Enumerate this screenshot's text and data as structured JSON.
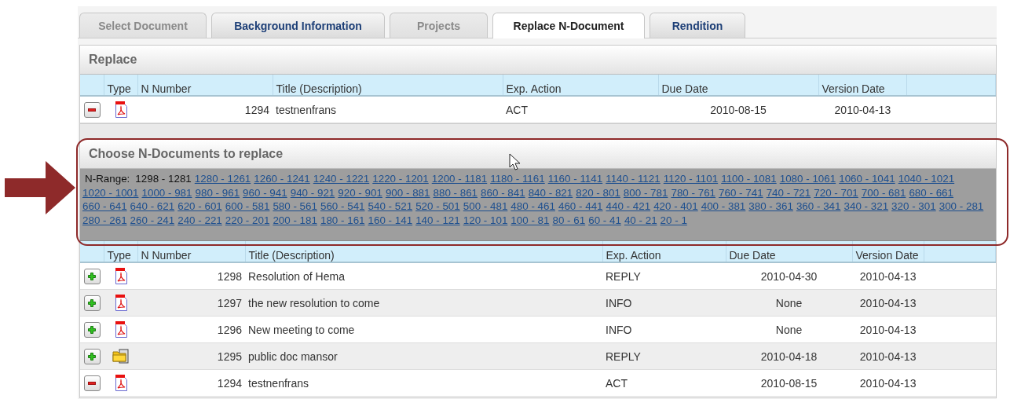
{
  "tabs": [
    {
      "label": "Select Document",
      "selected": false,
      "disabled": true
    },
    {
      "label": "Background Information",
      "selected": false,
      "disabled": false
    },
    {
      "label": "Projects",
      "selected": false,
      "disabled": true
    },
    {
      "label": "Replace N-Document",
      "selected": true,
      "disabled": false
    },
    {
      "label": "Rendition",
      "selected": false,
      "disabled": false
    }
  ],
  "replace": {
    "title": "Replace",
    "table": {
      "columns": [
        "Type",
        "N Number",
        "Title (Description)",
        "Exp. Action",
        "Due Date",
        "Version Date"
      ],
      "rows": [
        {
          "action": {
            "kind": "remove"
          },
          "type": {
            "kind": "pdf"
          },
          "n_number": "1294",
          "title": "testnenfrans",
          "exp_action": "ACT",
          "due_date": "2010-08-15",
          "version_date": "2010-04-13"
        }
      ]
    }
  },
  "choose": {
    "title": "Choose N-Documents to replace",
    "range_label": "N-Range:",
    "ranges": [
      {
        "label": "1298 - 1281",
        "selected": true
      },
      {
        "label": "1280 - 1261",
        "selected": false
      },
      {
        "label": "1260 - 1241",
        "selected": false
      },
      {
        "label": "1240 - 1221",
        "selected": false
      },
      {
        "label": "1220 - 1201",
        "selected": false
      },
      {
        "label": "1200 - 1181",
        "selected": false
      },
      {
        "label": "1180 - 1161",
        "selected": false
      },
      {
        "label": "1160 - 1141",
        "selected": false
      },
      {
        "label": "1140 - 1121",
        "selected": false
      },
      {
        "label": "1120 - 1101",
        "selected": false
      },
      {
        "label": "1100 - 1081",
        "selected": false
      },
      {
        "label": "1080 - 1061",
        "selected": false
      },
      {
        "label": "1060 - 1041",
        "selected": false
      },
      {
        "label": "1040 - 1021",
        "selected": false
      },
      {
        "label": "1020 - 1001",
        "selected": false
      },
      {
        "label": "1000 - 981",
        "selected": false
      },
      {
        "label": "980 - 961",
        "selected": false
      },
      {
        "label": "960 - 941",
        "selected": false
      },
      {
        "label": "940 - 921",
        "selected": false
      },
      {
        "label": "920 - 901",
        "selected": false
      },
      {
        "label": "900 - 881",
        "selected": false
      },
      {
        "label": "880 - 861",
        "selected": false
      },
      {
        "label": "860 - 841",
        "selected": false
      },
      {
        "label": "840 - 821",
        "selected": false
      },
      {
        "label": "820 - 801",
        "selected": false
      },
      {
        "label": "800 - 781",
        "selected": false
      },
      {
        "label": "780 - 761",
        "selected": false
      },
      {
        "label": "760 - 741",
        "selected": false
      },
      {
        "label": "740 - 721",
        "selected": false
      },
      {
        "label": "720 - 701",
        "selected": false
      },
      {
        "label": "700 - 681",
        "selected": false
      },
      {
        "label": "680 - 661",
        "selected": false
      },
      {
        "label": "660 - 641",
        "selected": false
      },
      {
        "label": "640 - 621",
        "selected": false
      },
      {
        "label": "620 - 601",
        "selected": false
      },
      {
        "label": "600 - 581",
        "selected": false
      },
      {
        "label": "580 - 561",
        "selected": false
      },
      {
        "label": "560 - 541",
        "selected": false
      },
      {
        "label": "540 - 521",
        "selected": false
      },
      {
        "label": "520 - 501",
        "selected": false
      },
      {
        "label": "500 - 481",
        "selected": false
      },
      {
        "label": "480 - 461",
        "selected": false
      },
      {
        "label": "460 - 441",
        "selected": false
      },
      {
        "label": "440 - 421",
        "selected": false
      },
      {
        "label": "420 - 401",
        "selected": false
      },
      {
        "label": "400 - 381",
        "selected": false
      },
      {
        "label": "380 - 361",
        "selected": false
      },
      {
        "label": "360 - 341",
        "selected": false
      },
      {
        "label": "340 - 321",
        "selected": false
      },
      {
        "label": "320 - 301",
        "selected": false
      },
      {
        "label": "300 - 281",
        "selected": false
      },
      {
        "label": "280 - 261",
        "selected": false
      },
      {
        "label": "260 - 241",
        "selected": false
      },
      {
        "label": "240 - 221",
        "selected": false
      },
      {
        "label": "220 - 201",
        "selected": false
      },
      {
        "label": "200 - 181",
        "selected": false
      },
      {
        "label": "180 - 161",
        "selected": false
      },
      {
        "label": "160 - 141",
        "selected": false
      },
      {
        "label": "140 - 121",
        "selected": false
      },
      {
        "label": "120 - 101",
        "selected": false
      },
      {
        "label": "100 - 81",
        "selected": false
      },
      {
        "label": "80 - 61",
        "selected": false
      },
      {
        "label": "60 - 41",
        "selected": false
      },
      {
        "label": "40 - 21",
        "selected": false
      },
      {
        "label": "20 - 1",
        "selected": false
      }
    ],
    "table": {
      "columns": [
        "Type",
        "N Number",
        "Title (Description)",
        "Exp. Action",
        "Due Date",
        "Version Date"
      ],
      "rows": [
        {
          "action": {
            "kind": "add"
          },
          "type": {
            "kind": "pdf"
          },
          "n_number": "1298",
          "title": "Resolution of Hema",
          "exp_action": "REPLY",
          "due_date": "2010-04-30",
          "version_date": "2010-04-13"
        },
        {
          "action": {
            "kind": "add"
          },
          "type": {
            "kind": "pdf"
          },
          "n_number": "1297",
          "title": "the new resolution to come",
          "exp_action": "INFO",
          "due_date": "None",
          "version_date": "2010-04-13"
        },
        {
          "action": {
            "kind": "add"
          },
          "type": {
            "kind": "pdf"
          },
          "n_number": "1296",
          "title": "New meeting to come",
          "exp_action": "INFO",
          "due_date": "None",
          "version_date": "2010-04-13"
        },
        {
          "action": {
            "kind": "add"
          },
          "type": {
            "kind": "folder"
          },
          "n_number": "1295",
          "title": "public doc mansor",
          "exp_action": "REPLY",
          "due_date": "2010-04-18",
          "version_date": "2010-04-13"
        },
        {
          "action": {
            "kind": "remove"
          },
          "type": {
            "kind": "pdf"
          },
          "n_number": "1294",
          "title": "testnenfrans",
          "exp_action": "ACT",
          "due_date": "2010-08-15",
          "version_date": "2010-04-13"
        }
      ]
    }
  }
}
